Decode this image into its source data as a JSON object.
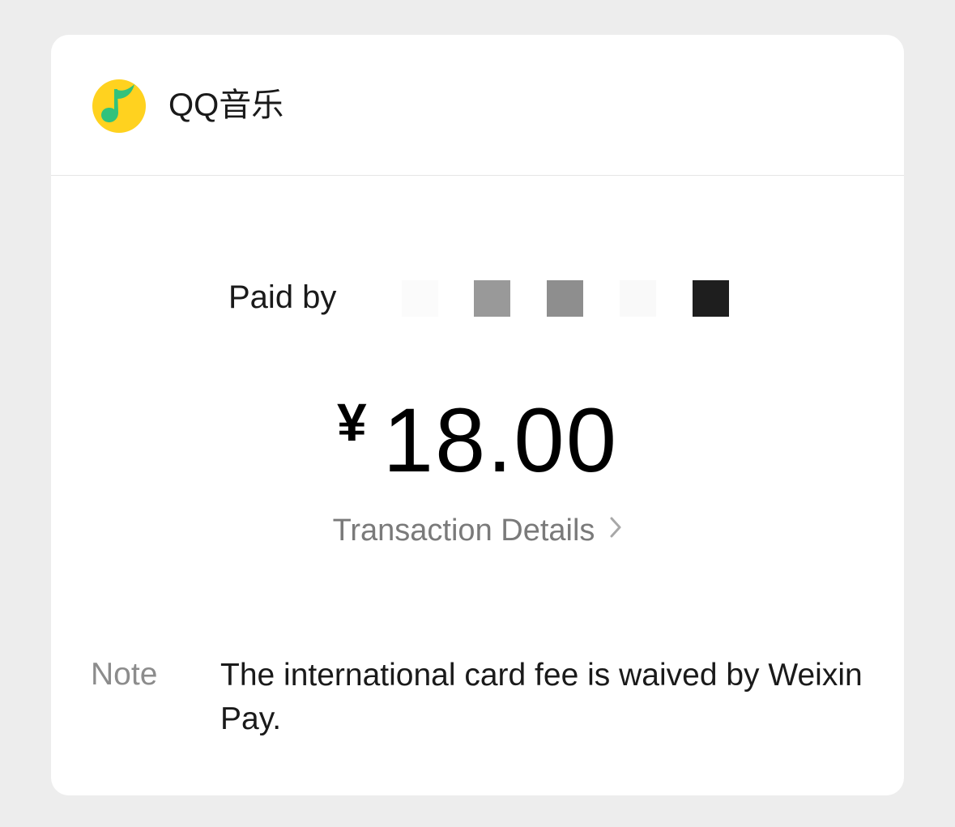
{
  "merchant": {
    "logo_icon": "qq-music-logo-icon",
    "logo_colors": {
      "background": "#ffd21f",
      "note": "#31c27c"
    },
    "name": "QQ音乐"
  },
  "payment": {
    "paid_by_label": "Paid by",
    "currency_symbol": "¥",
    "amount": "18.00",
    "details_link_label": "Transaction Details",
    "details_icon": "chevron-right-icon"
  },
  "note": {
    "label": "Note",
    "text": "The international card fee is waived by Weixin Pay."
  },
  "colors": {
    "page_background": "#ededed",
    "card_background": "#ffffff",
    "secondary_text": "#7a7a7a"
  }
}
